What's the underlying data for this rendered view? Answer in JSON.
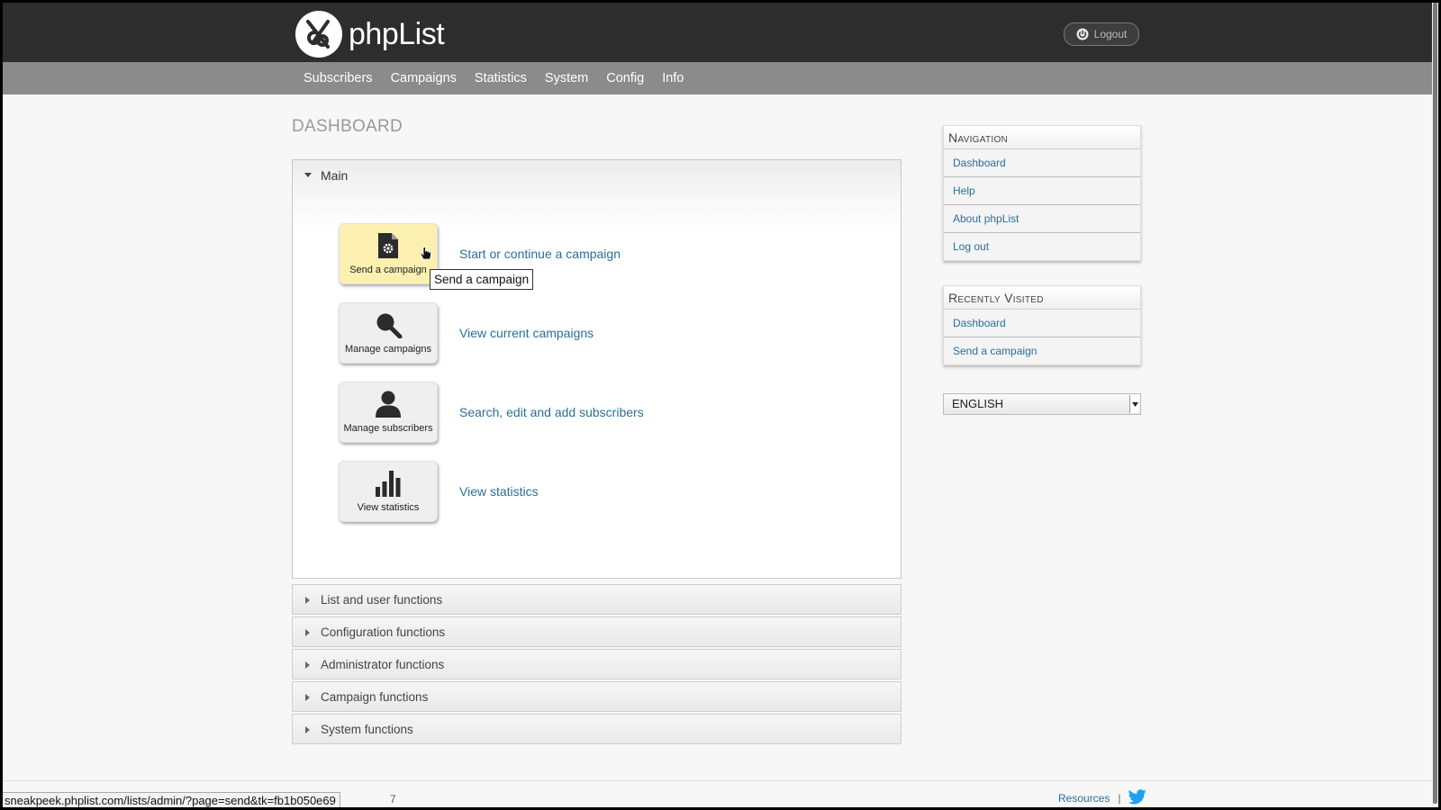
{
  "header": {
    "logo_text": "phpList",
    "logout_label": "Logout"
  },
  "menu": {
    "items": [
      "Subscribers",
      "Campaigns",
      "Statistics",
      "System",
      "Config",
      "Info"
    ]
  },
  "page": {
    "title": "DASHBOARD"
  },
  "main_section": {
    "title": "Main",
    "rows": [
      {
        "tile_label": "Send a campaign",
        "link": "Start or continue a campaign",
        "icon": "send-campaign-icon"
      },
      {
        "tile_label": "Manage campaigns",
        "link": "View current campaigns",
        "icon": "magnifier-icon"
      },
      {
        "tile_label": "Manage subscribers",
        "link": "Search, edit and add subscribers",
        "icon": "user-icon"
      },
      {
        "tile_label": "View statistics",
        "link": "View statistics",
        "icon": "bar-chart-icon"
      }
    ],
    "tooltip": "Send a campaign"
  },
  "collapsed_sections": [
    "List and user functions",
    "Configuration functions",
    "Administrator functions",
    "Campaign functions",
    "System functions"
  ],
  "sidebar": {
    "navigation": {
      "title": "Navigation",
      "items": [
        "Dashboard",
        "Help",
        "About phpList",
        "Log out"
      ]
    },
    "recently_visited": {
      "title": "Recently Visited",
      "items": [
        "Dashboard",
        "Send a campaign"
      ]
    },
    "language": {
      "selected": "ENGLISH"
    }
  },
  "footer": {
    "resources_label": "Resources",
    "separator": "|",
    "status_url": "sneakpeek.phplist.com/lists/admin/?page=send&tk=fb1b050e69",
    "status_tail": "7"
  },
  "colors": {
    "header_bg": "#2d2d2d",
    "menu_bg": "#8b8b8b",
    "link": "#2a6f9b",
    "tile_hover": "#fbf0b0",
    "twitter": "#1da1f2"
  }
}
